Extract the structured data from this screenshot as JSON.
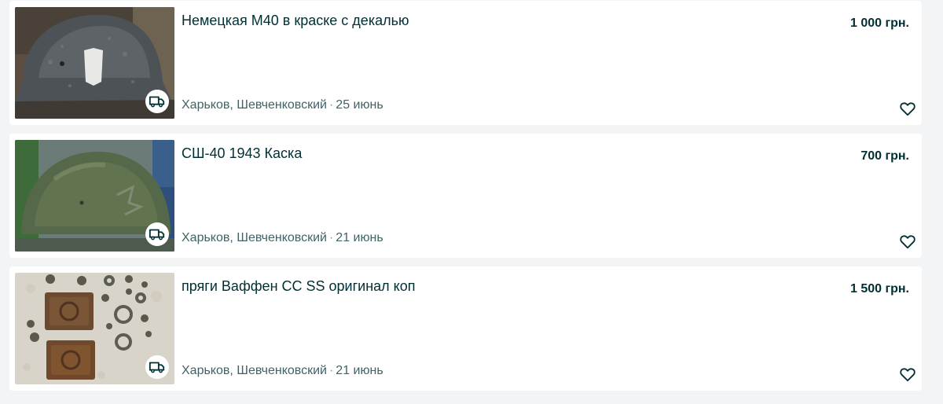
{
  "listings": [
    {
      "title": "Немецкая М40 в краске с декалью",
      "price": "1 000 грн.",
      "location": "Харьков, Шевченковский",
      "date": "25 июнь",
      "delivery_icon": "delivery-truck-icon",
      "favorite_icon": "heart-outline-icon"
    },
    {
      "title": "СШ-40 1943 Каска",
      "price": "700 грн.",
      "location": "Харьков, Шевченковский",
      "date": "21 июнь",
      "delivery_icon": "delivery-truck-icon",
      "favorite_icon": "heart-outline-icon"
    },
    {
      "title": "пряги Ваффен СС SS оригинал коп",
      "price": "1 500 грн.",
      "location": "Харьков, Шевченковский",
      "date": "21 июнь",
      "delivery_icon": "delivery-truck-icon",
      "favorite_icon": "heart-outline-icon"
    }
  ],
  "meta_separator": "·",
  "colors": {
    "page_bg": "#f2f4f5",
    "card_bg": "#ffffff",
    "text_primary": "#002f34",
    "text_secondary": "#406367"
  }
}
